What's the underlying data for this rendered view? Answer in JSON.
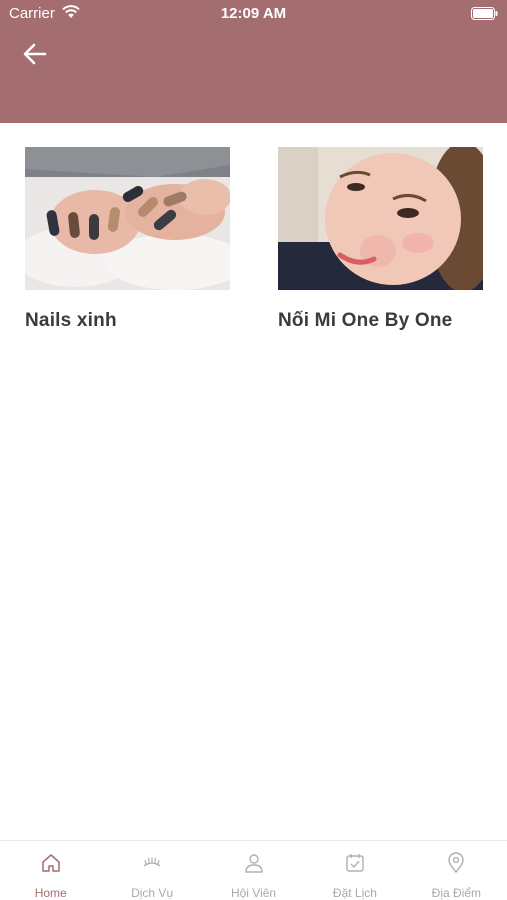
{
  "status_bar": {
    "carrier": "Carrier",
    "time": "12:09 AM"
  },
  "header": {
    "back_icon": "arrow-left-icon",
    "color": "#a46d6f"
  },
  "cards": [
    {
      "title": "Nails xinh",
      "image": "nails-photo"
    },
    {
      "title": "Nối Mi One By One",
      "image": "eyelash-portrait-photo"
    }
  ],
  "tabbar": {
    "active_color": "#a46d6f",
    "inactive_color": "#a9a9a9",
    "tabs": [
      {
        "label": "Home",
        "icon": "home-icon",
        "active": true
      },
      {
        "label": "Dịch Vụ",
        "icon": "eyelash-icon",
        "active": false
      },
      {
        "label": "Hội Viên",
        "icon": "user-icon",
        "active": false
      },
      {
        "label": "Đặt Lịch",
        "icon": "calendar-check-icon",
        "active": false
      },
      {
        "label": "Địa Điểm",
        "icon": "location-pin-icon",
        "active": false
      }
    ]
  }
}
